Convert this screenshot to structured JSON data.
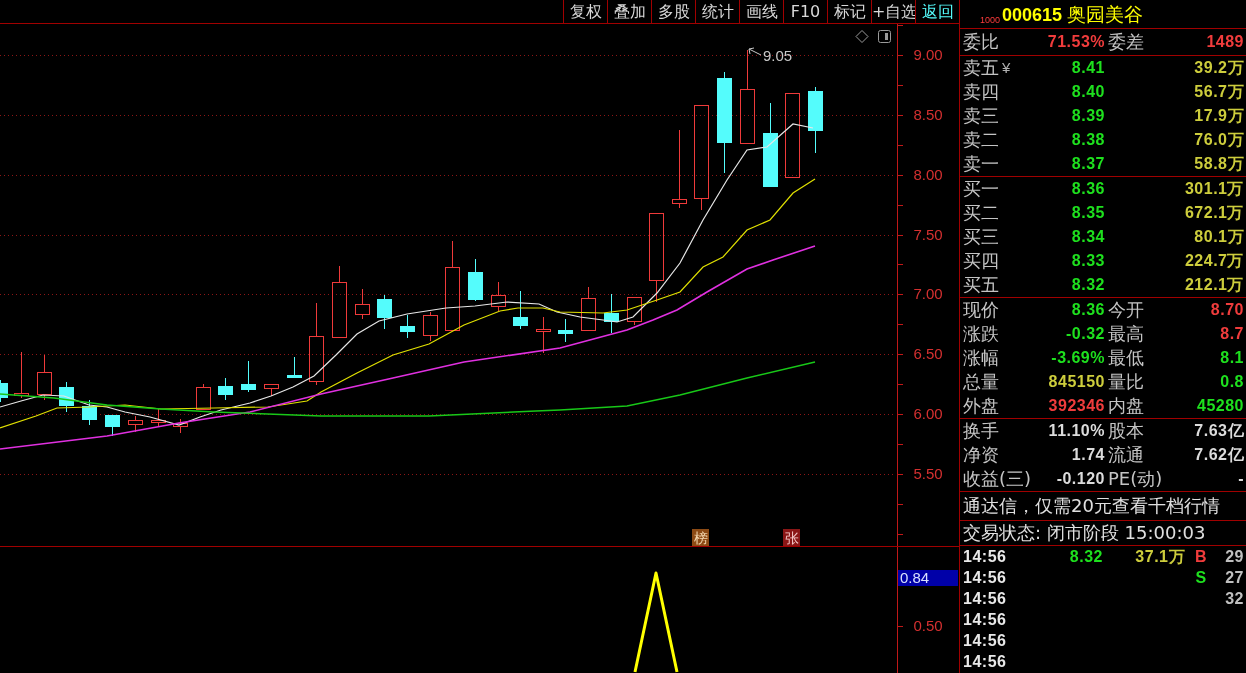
{
  "toolbar": {
    "buttons": [
      {
        "label": "复权",
        "kind": "tool"
      },
      {
        "label": "叠加",
        "kind": "tool"
      },
      {
        "label": "多股",
        "kind": "tool"
      },
      {
        "label": "统计",
        "kind": "tool"
      },
      {
        "label": "画线",
        "kind": "tool"
      },
      {
        "label": "F10",
        "kind": "tool"
      },
      {
        "label": "标记",
        "kind": "tool"
      },
      {
        "label": "+自选",
        "kind": "tool"
      },
      {
        "label": "返回",
        "kind": "back"
      }
    ]
  },
  "price_chart": {
    "axis_labels": [
      "9.00",
      "8.50",
      "8.00",
      "7.50",
      "7.00",
      "6.50",
      "6.00",
      "5.50"
    ],
    "peak_label": "9.05",
    "tags": [
      {
        "text": "榜",
        "kind": "ranking"
      },
      {
        "text": "张",
        "kind": "limit"
      }
    ]
  },
  "indicator_chart": {
    "axis_labels": [
      {
        "text": "0.84",
        "kind": "current"
      },
      {
        "text": "0.50",
        "kind": "tick"
      }
    ]
  },
  "quote": {
    "market": "1000",
    "code": "000615",
    "name": "奥园美谷"
  },
  "order_ratio": [
    {
      "label": "委比",
      "value": "71.53%",
      "color": "#f03c3c"
    },
    {
      "label": "委差",
      "value": "1489",
      "color": "#f03c3c"
    }
  ],
  "sell_levels": [
    {
      "label": "卖五",
      "marker": "¥",
      "price": "8.41",
      "color": "#1ee01e",
      "volume": "39.2万"
    },
    {
      "label": "卖四",
      "price": "8.40",
      "color": "#1ee01e",
      "volume": "56.7万"
    },
    {
      "label": "卖三",
      "price": "8.39",
      "color": "#1ee01e",
      "volume": "17.9万"
    },
    {
      "label": "卖二",
      "price": "8.38",
      "color": "#1ee01e",
      "volume": "76.0万"
    },
    {
      "label": "卖一",
      "price": "8.37",
      "color": "#1ee01e",
      "volume": "58.8万"
    }
  ],
  "buy_levels": [
    {
      "label": "买一",
      "price": "8.36",
      "color": "#1ee01e",
      "volume": "301.1万"
    },
    {
      "label": "买二",
      "price": "8.35",
      "color": "#1ee01e",
      "volume": "672.1万"
    },
    {
      "label": "买三",
      "price": "8.34",
      "color": "#1ee01e",
      "volume": "80.1万"
    },
    {
      "label": "买四",
      "price": "8.33",
      "color": "#1ee01e",
      "volume": "224.7万"
    },
    {
      "label": "买五",
      "price": "8.32",
      "color": "#1ee01e",
      "volume": "212.1万"
    }
  ],
  "stats": [
    {
      "label": "现价",
      "value": "8.36",
      "color": "#1ee01e"
    },
    {
      "label": "今开",
      "value": "8.70",
      "color": "#f03c3c"
    },
    {
      "label": "涨跌",
      "value": "-0.32",
      "color": "#1ee01e"
    },
    {
      "label": "最高",
      "value": "8.7",
      "color": "#f03c3c"
    },
    {
      "label": "涨幅",
      "value": "-3.69%",
      "color": "#1ee01e"
    },
    {
      "label": "最低",
      "value": "8.1",
      "color": "#1ee01e"
    },
    {
      "label": "总量",
      "value": "845150",
      "color": "#cdcd3c"
    },
    {
      "label": "量比",
      "value": "0.8",
      "color": "#1ee01e"
    },
    {
      "label": "外盘",
      "value": "392346",
      "color": "#f03c3c"
    },
    {
      "label": "内盘",
      "value": "45280",
      "color": "#1ee01e"
    }
  ],
  "fundamentals": [
    {
      "label": "换手",
      "value": "11.10%",
      "color": "#dcdcdc"
    },
    {
      "label": "股本",
      "value": "7.63亿",
      "color": "#dcdcdc"
    },
    {
      "label": "净资",
      "value": "1.74",
      "color": "#dcdcdc"
    },
    {
      "label": "流通",
      "value": "7.62亿",
      "color": "#dcdcdc"
    },
    {
      "label": "收益(三)",
      "value": "-0.120",
      "color": "#dcdcdc"
    },
    {
      "label": "PE(动)",
      "value": "-",
      "color": "#dcdcdc"
    }
  ],
  "notice": "通达信，仅需20元查看千档行情",
  "trade_status": "交易状态: 闭市阶段 15:00:03",
  "ticks": [
    {
      "time": "14:56",
      "price": {
        "text": "8.32",
        "color": "#1ee01e"
      },
      "volume": "37.1万",
      "side": {
        "text": "B",
        "color": "#f03c3c"
      },
      "count": "29"
    },
    {
      "time": "14:56",
      "side": {
        "text": "S",
        "color": "#1ee01e"
      },
      "count": "27"
    },
    {
      "time": "14:56",
      "count": "32"
    },
    {
      "time": "14:56"
    },
    {
      "time": "14:56"
    },
    {
      "time": "14:56"
    }
  ]
}
